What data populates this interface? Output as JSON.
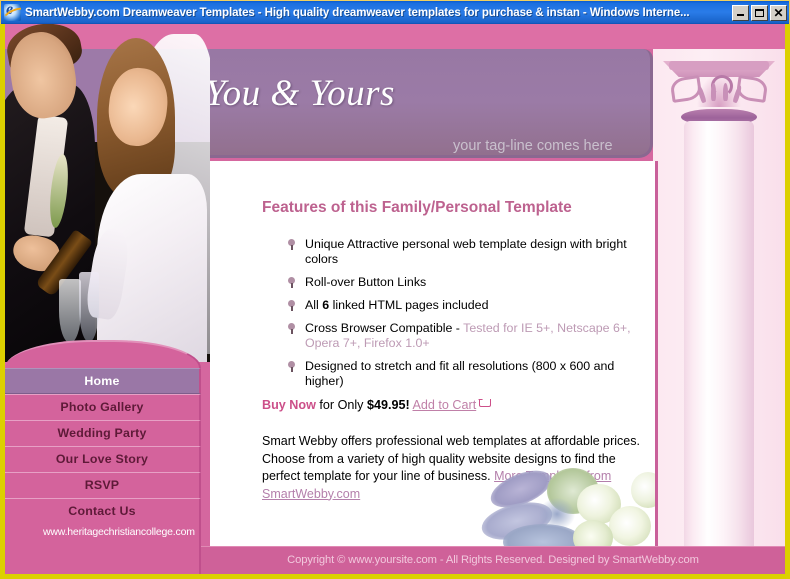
{
  "window": {
    "title": "SmartWebby.com Dreamweaver Templates - High quality dreamweaver templates for purchase & instan - Windows Interne...",
    "app_icon": "internet-explorer-icon",
    "controls": {
      "minimize": "minimize-icon",
      "maximize": "maximize-icon",
      "close": "close-icon"
    }
  },
  "site": {
    "title": "You & Yours",
    "tagline": "your tag-line comes here"
  },
  "nav": {
    "items": [
      {
        "label": "Home",
        "active": true
      },
      {
        "label": "Photo Gallery",
        "active": false
      },
      {
        "label": "Wedding Party",
        "active": false
      },
      {
        "label": "Our Love Story",
        "active": false
      },
      {
        "label": "RSVP",
        "active": false
      },
      {
        "label": "Contact Us",
        "active": false
      }
    ]
  },
  "content": {
    "heading": "Features of this Family/Personal Template",
    "features": [
      {
        "text": "Unique Attractive personal web template design with bright colors"
      },
      {
        "text": "Roll-over Button Links"
      },
      {
        "prefix": "All ",
        "bold": "6",
        "suffix": " linked HTML pages included"
      },
      {
        "text": "Cross Browser Compatible - ",
        "muted": "Tested for IE 5+, Netscape 6+, Opera 7+, Firefox 1.0+"
      },
      {
        "text": "Designed to stretch and fit all resolutions (800 x 600 and higher)"
      }
    ],
    "buy": {
      "buy_now": "Buy Now",
      "for_only": " for Only ",
      "price": "$49.95!",
      "cart_link": "Add to Cart",
      "cart_icon": "shopping-cart-icon"
    },
    "blurb": {
      "text": "Smart Webby offers professional web templates at affordable prices. Choose from a variety of high quality website designs to find the perfect template for your line of business. ",
      "link": "More Templates from SmartWebby.com"
    }
  },
  "sidebar": {
    "college_url": "www.heritagechristiancollege.com"
  },
  "footer": {
    "copyright": "Copyright © www.yoursite.com - All Rights Reserved. Designed by SmartWebby.com"
  },
  "decor": {
    "hero_photo": "wedding-couple-photo",
    "column": "decorative-pillar-graphic",
    "flowers": "floral-bouquet-photo"
  },
  "colors": {
    "pink": "#d4639c",
    "deep_pink": "#cf6199",
    "purple": "#9a77a6",
    "heading_pink": "#bd628f",
    "link_mauve": "#b47fab",
    "frame_yellow": "#dcd000",
    "titlebar_blue": "#2a7ce8"
  }
}
